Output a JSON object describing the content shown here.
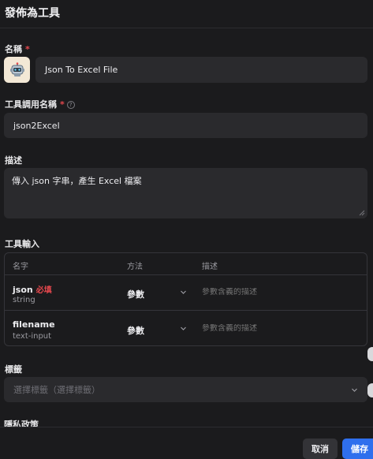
{
  "dialog": {
    "title": "發佈為工具"
  },
  "name": {
    "label": "名稱",
    "required_mark": "*",
    "avatar_icon": "robot-icon",
    "value": "Json To Excel File"
  },
  "tool_call_name": {
    "label": "工具調用名稱",
    "required_mark": "*",
    "help": "?",
    "value": "json2Excel"
  },
  "description": {
    "label": "描述",
    "value": "傳入 json 字串，產生 Excel 檔案"
  },
  "tool_input": {
    "label": "工具輸入",
    "columns": [
      "名字",
      "方法",
      "描述"
    ],
    "rows": [
      {
        "name": "json",
        "required": "必填",
        "type": "string",
        "method": "參數",
        "desc_placeholder": "參數含義的描述"
      },
      {
        "name": "filename",
        "required": "",
        "type": "text-input",
        "method": "參數",
        "desc_placeholder": "參數含義的描述"
      }
    ]
  },
  "tags": {
    "label": "標籤",
    "placeholder": "選擇標籤（選擇標籤）"
  },
  "next_section_label": "隱私政策",
  "footer": {
    "cancel_label": "取消",
    "save_label": "儲存"
  },
  "colors": {
    "background": "#1b1b1d",
    "field": "#2a2a2d",
    "required": "#e5484d",
    "primary": "#2f6fed"
  }
}
